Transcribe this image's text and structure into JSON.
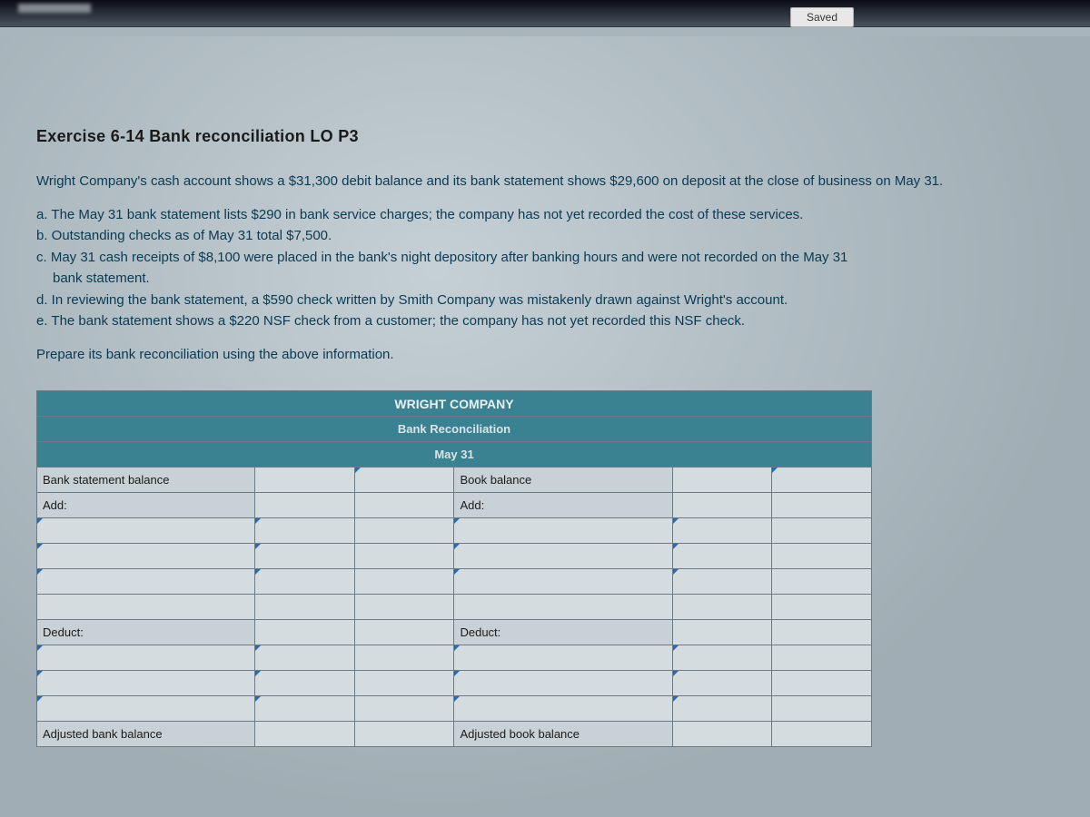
{
  "status": {
    "saved": "Saved"
  },
  "exercise": {
    "title": "Exercise 6-14 Bank reconciliation LO P3",
    "intro": "Wright Company's cash account shows a $31,300 debit balance and its bank statement shows $29,600 on deposit at the close of business on May 31.",
    "items": {
      "a": "a. The May 31 bank statement lists $290 in bank service charges; the company has not yet recorded the cost of these services.",
      "b": "b. Outstanding checks as of May 31 total $7,500.",
      "c_line1": "c. May 31 cash receipts of $8,100 were placed in the bank's night depository after banking hours and were not recorded on the May 31",
      "c_line2": "bank statement.",
      "d": "d. In reviewing the bank statement, a $590 check written by Smith Company was mistakenly drawn against Wright's account.",
      "e": "e. The bank statement shows a $220 NSF check from a customer; the company has not yet recorded this NSF check."
    },
    "instruction": "Prepare its bank reconciliation using the above information."
  },
  "table": {
    "company": "WRIGHT COMPANY",
    "heading": "Bank Reconciliation",
    "date": "May 31",
    "left": {
      "balance": "Bank statement balance",
      "add": "Add:",
      "deduct": "Deduct:",
      "adjusted": "Adjusted bank balance"
    },
    "right": {
      "balance": "Book balance",
      "add": "Add:",
      "deduct": "Deduct:",
      "adjusted": "Adjusted book balance"
    }
  }
}
